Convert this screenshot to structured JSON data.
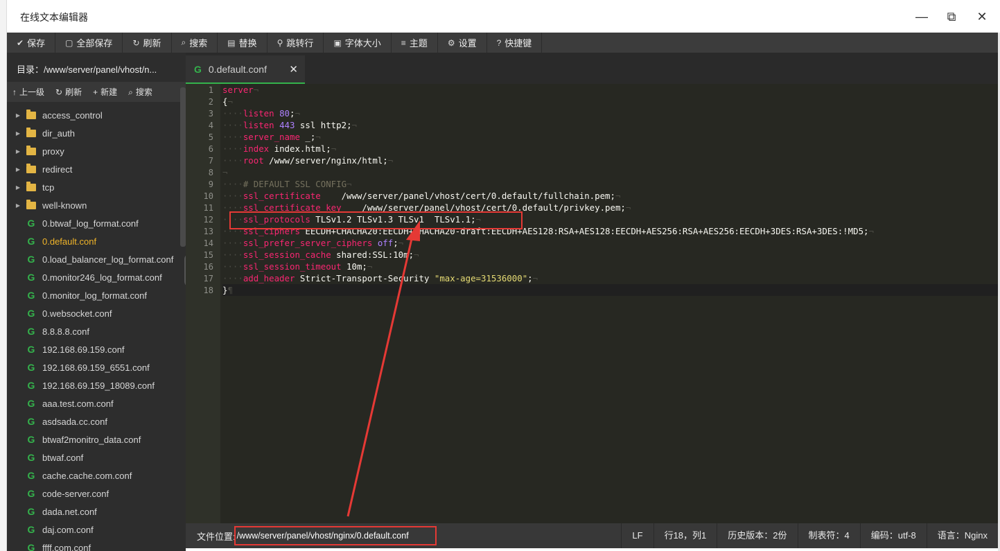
{
  "window": {
    "title": "在线文本编辑器",
    "minimize": "—",
    "maximize": "⧉",
    "close": "✕"
  },
  "toolbar": [
    {
      "icon": "✔",
      "label": "保存",
      "name": "save"
    },
    {
      "icon": "▢",
      "label": "全部保存",
      "name": "save-all"
    },
    {
      "icon": "↻",
      "label": "刷新",
      "name": "refresh"
    },
    {
      "icon": "⌕",
      "label": "搜索",
      "name": "search"
    },
    {
      "icon": "▤",
      "label": "替换",
      "name": "replace"
    },
    {
      "icon": "⚲",
      "label": "跳转行",
      "name": "goto-line"
    },
    {
      "icon": "▣",
      "label": "字体大小",
      "name": "font-size"
    },
    {
      "icon": "≡",
      "label": "主题",
      "name": "theme"
    },
    {
      "icon": "⚙",
      "label": "设置",
      "name": "settings"
    },
    {
      "icon": "?",
      "label": "快捷键",
      "name": "shortcuts"
    }
  ],
  "sidebar": {
    "dir_label": "目录：/www/server/panel/vhost/n...",
    "actions": [
      {
        "icon": "↑",
        "label": "上一级",
        "name": "up-level"
      },
      {
        "icon": "↻",
        "label": "刷新",
        "name": "refresh"
      },
      {
        "icon": "+",
        "label": "新建",
        "name": "new"
      },
      {
        "icon": "⌕",
        "label": "搜索",
        "name": "search"
      }
    ],
    "items": [
      {
        "type": "folder",
        "label": "access_control"
      },
      {
        "type": "folder",
        "label": "dir_auth"
      },
      {
        "type": "folder",
        "label": "proxy"
      },
      {
        "type": "folder",
        "label": "redirect"
      },
      {
        "type": "folder",
        "label": "tcp"
      },
      {
        "type": "folder",
        "label": "well-known"
      },
      {
        "type": "file",
        "label": "0.btwaf_log_format.conf"
      },
      {
        "type": "file",
        "label": "0.default.conf",
        "active": true
      },
      {
        "type": "file",
        "label": "0.load_balancer_log_format.conf"
      },
      {
        "type": "file",
        "label": "0.monitor246_log_format.conf"
      },
      {
        "type": "file",
        "label": "0.monitor_log_format.conf"
      },
      {
        "type": "file",
        "label": "0.websocket.conf"
      },
      {
        "type": "file",
        "label": "8.8.8.8.conf"
      },
      {
        "type": "file",
        "label": "192.168.69.159.conf"
      },
      {
        "type": "file",
        "label": "192.168.69.159_6551.conf"
      },
      {
        "type": "file",
        "label": "192.168.69.159_18089.conf"
      },
      {
        "type": "file",
        "label": "aaa.test.com.conf"
      },
      {
        "type": "file",
        "label": "asdsada.cc.conf"
      },
      {
        "type": "file",
        "label": "btwaf2monitro_data.conf"
      },
      {
        "type": "file",
        "label": "btwaf.conf"
      },
      {
        "type": "file",
        "label": "cache.cache.com.conf"
      },
      {
        "type": "file",
        "label": "code-server.conf"
      },
      {
        "type": "file",
        "label": "dada.net.conf"
      },
      {
        "type": "file",
        "label": "daj.com.conf"
      },
      {
        "type": "file",
        "label": "ffff.com.conf"
      }
    ]
  },
  "editor": {
    "tab_label": "0.default.conf",
    "tab_close": "✕",
    "lines": [
      "1",
      "2",
      "3",
      "4",
      "5",
      "6",
      "7",
      "8",
      "9",
      "10",
      "11",
      "12",
      "13",
      "14",
      "15",
      "16",
      "17",
      "18"
    ]
  },
  "statusbar": {
    "path_label": "文件位置:",
    "path": "/www/server/panel/vhost/nginx/0.default.conf",
    "line_ending": "LF",
    "cursor": "行18，列1",
    "history": "历史版本：2份",
    "tab_size": "制表符：4",
    "encoding": "编码：utf-8",
    "language": "语言：Nginx"
  }
}
